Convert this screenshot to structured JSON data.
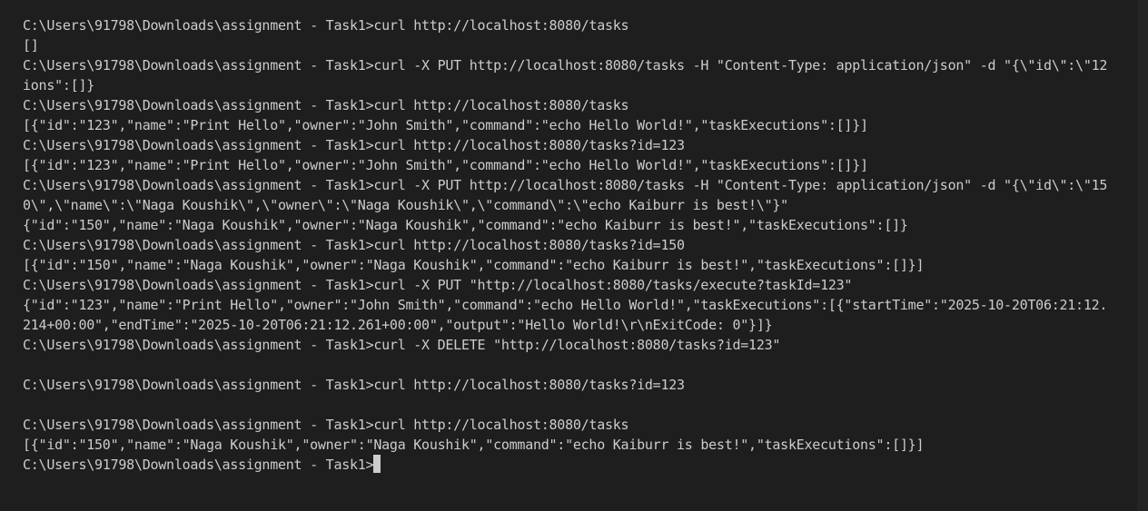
{
  "terminal": {
    "lines": [
      "C:\\Users\\91798\\Downloads\\assignment - Task1>curl http://localhost:8080/tasks",
      "[]",
      "C:\\Users\\91798\\Downloads\\assignment - Task1>curl -X PUT http://localhost:8080/tasks -H \"Content-Type: application/json\" -d \"{\\\"id\\\":\\\"12",
      "ions\":[]}",
      "C:\\Users\\91798\\Downloads\\assignment - Task1>curl http://localhost:8080/tasks",
      "[{\"id\":\"123\",\"name\":\"Print Hello\",\"owner\":\"John Smith\",\"command\":\"echo Hello World!\",\"taskExecutions\":[]}]",
      "C:\\Users\\91798\\Downloads\\assignment - Task1>curl http://localhost:8080/tasks?id=123",
      "[{\"id\":\"123\",\"name\":\"Print Hello\",\"owner\":\"John Smith\",\"command\":\"echo Hello World!\",\"taskExecutions\":[]}]",
      "C:\\Users\\91798\\Downloads\\assignment - Task1>curl -X PUT http://localhost:8080/tasks -H \"Content-Type: application/json\" -d \"{\\\"id\\\":\\\"15",
      "0\\\",\\\"name\\\":\\\"Naga Koushik\\\",\\\"owner\\\":\\\"Naga Koushik\\\",\\\"command\\\":\\\"echo Kaiburr is best!\\\"}\"",
      "{\"id\":\"150\",\"name\":\"Naga Koushik\",\"owner\":\"Naga Koushik\",\"command\":\"echo Kaiburr is best!\",\"taskExecutions\":[]}",
      "C:\\Users\\91798\\Downloads\\assignment - Task1>curl http://localhost:8080/tasks?id=150",
      "[{\"id\":\"150\",\"name\":\"Naga Koushik\",\"owner\":\"Naga Koushik\",\"command\":\"echo Kaiburr is best!\",\"taskExecutions\":[]}]",
      "C:\\Users\\91798\\Downloads\\assignment - Task1>curl -X PUT \"http://localhost:8080/tasks/execute?taskId=123\"",
      "{\"id\":\"123\",\"name\":\"Print Hello\",\"owner\":\"John Smith\",\"command\":\"echo Hello World!\",\"taskExecutions\":[{\"startTime\":\"2025-10-20T06:21:12.",
      "214+00:00\",\"endTime\":\"2025-10-20T06:21:12.261+00:00\",\"output\":\"Hello World!\\r\\nExitCode: 0\"}]}",
      "C:\\Users\\91798\\Downloads\\assignment - Task1>curl -X DELETE \"http://localhost:8080/tasks?id=123\"",
      "",
      "C:\\Users\\91798\\Downloads\\assignment - Task1>curl http://localhost:8080/tasks?id=123",
      "",
      "C:\\Users\\91798\\Downloads\\assignment - Task1>curl http://localhost:8080/tasks",
      "[{\"id\":\"150\",\"name\":\"Naga Koushik\",\"owner\":\"Naga Koushik\",\"command\":\"echo Kaiburr is best!\",\"taskExecutions\":[]}]"
    ],
    "prompt": "C:\\Users\\91798\\Downloads\\assignment - Task1>"
  },
  "colors": {
    "background": "#1e1e1e",
    "text": "#cccccc",
    "cursor": "#cccccc"
  }
}
